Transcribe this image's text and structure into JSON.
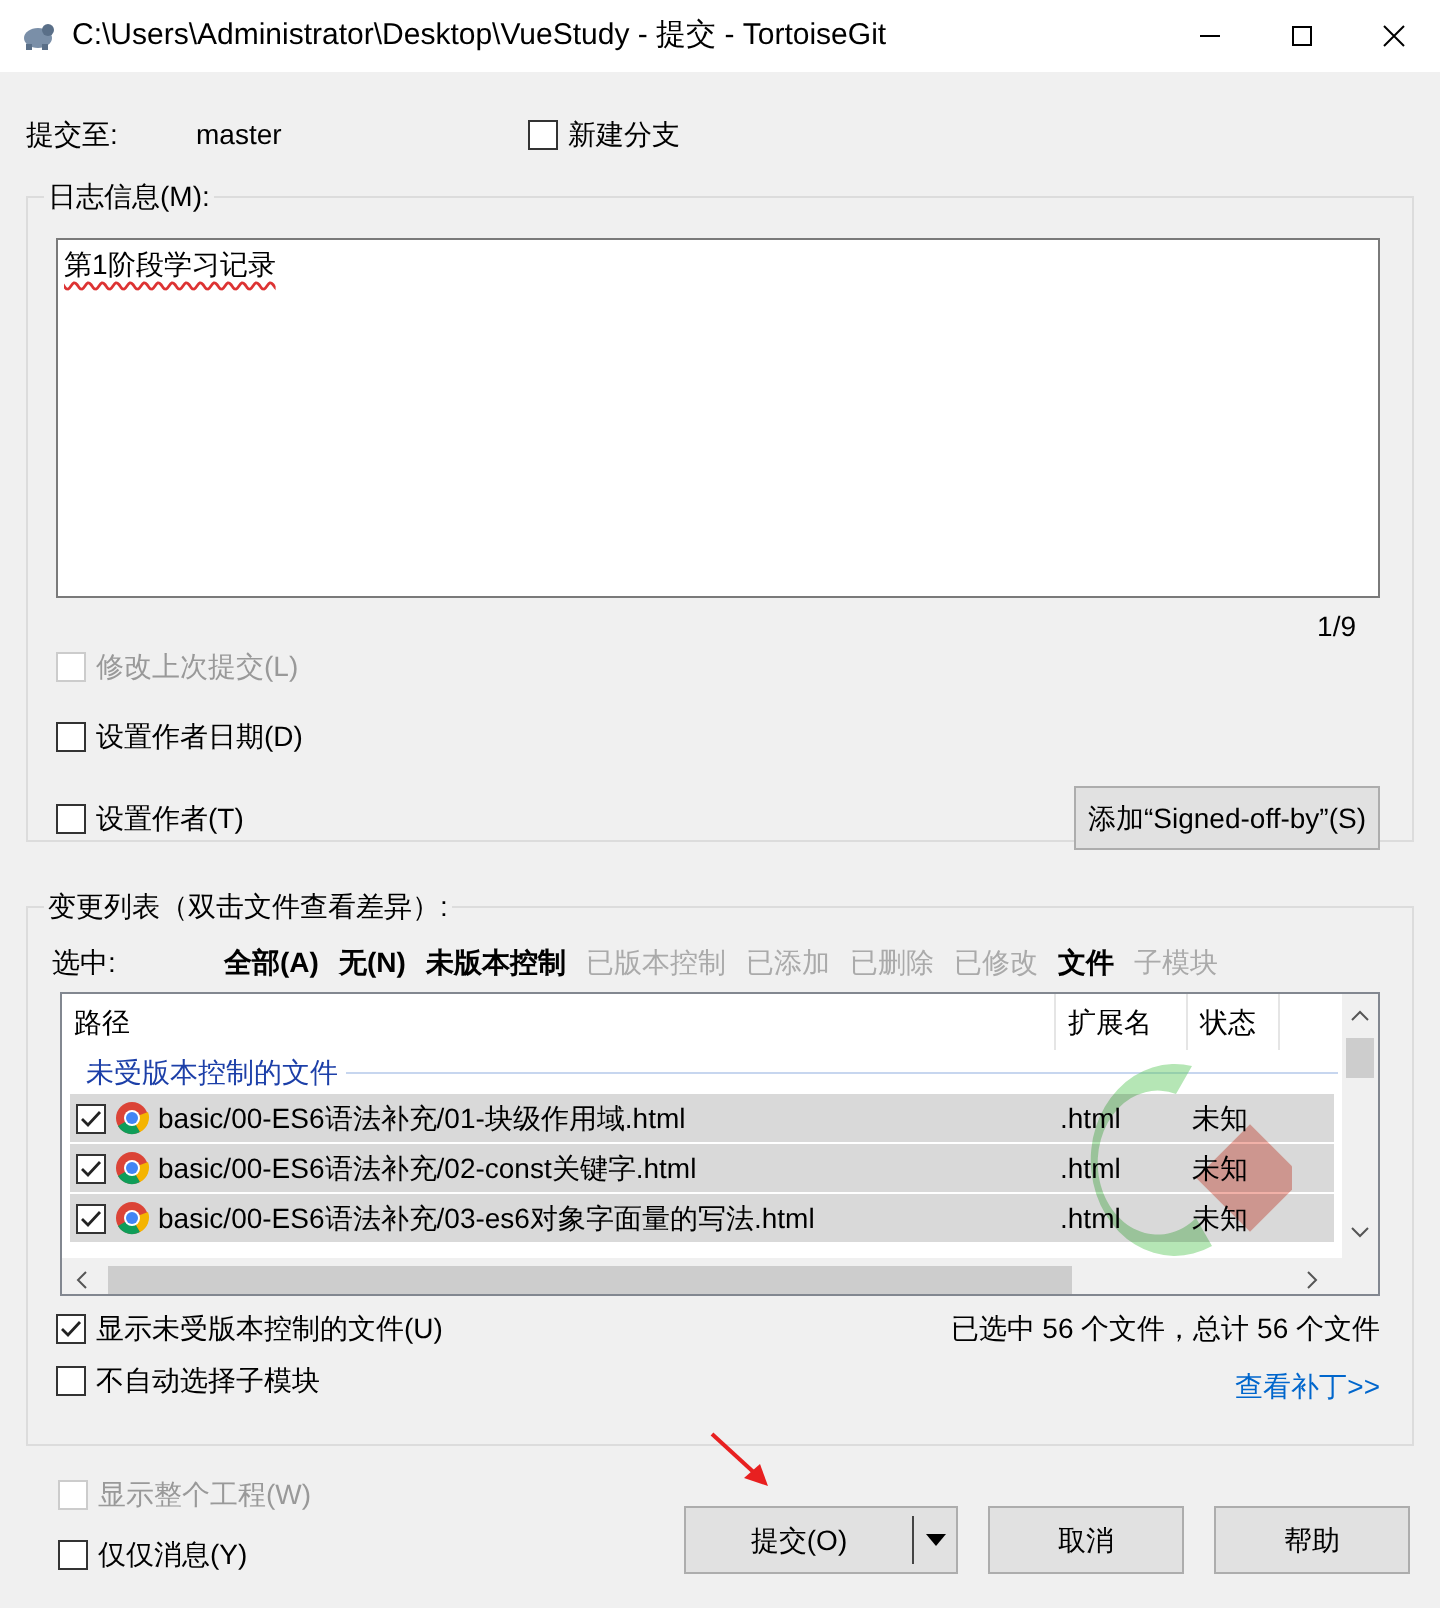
{
  "window": {
    "title": "C:\\Users\\Administrator\\Desktop\\VueStudy - 提交 - TortoiseGit"
  },
  "commit_to": {
    "label": "提交至:",
    "branch": "master"
  },
  "new_branch": {
    "label": "新建分支",
    "checked": false
  },
  "log_message": {
    "legend": "日志信息(M):",
    "value": "第1阶段学习记录",
    "counter": "1/9"
  },
  "options": [
    {
      "label": "修改上次提交(L)",
      "checked": false,
      "disabled": true
    },
    {
      "label": "设置作者日期(D)",
      "checked": false,
      "disabled": false
    },
    {
      "label": "设置作者(T)",
      "checked": false,
      "disabled": false
    }
  ],
  "signoff_button": "添加“Signed-off-by”(S)",
  "changes": {
    "legend": "变更列表（双击文件查看差异）:",
    "select_label": "选中:",
    "filters": [
      {
        "label": "全部(A)",
        "disabled": false
      },
      {
        "label": "无(N)",
        "disabled": false
      },
      {
        "label": "未版本控制",
        "disabled": false
      },
      {
        "label": "已版本控制",
        "disabled": true
      },
      {
        "label": "已添加",
        "disabled": true
      },
      {
        "label": "已删除",
        "disabled": true
      },
      {
        "label": "已修改",
        "disabled": true
      },
      {
        "label": "文件",
        "disabled": false
      },
      {
        "label": "子模块",
        "disabled": true
      }
    ],
    "columns": [
      "路径",
      "扩展名",
      "状态"
    ],
    "group": "未受版本控制的文件",
    "rows": [
      {
        "checked": true,
        "path": "basic/00-ES6语法补充/01-块级作用域.html",
        "ext": ".html",
        "status": "未知"
      },
      {
        "checked": true,
        "path": "basic/00-ES6语法补充/02-const关键字.html",
        "ext": ".html",
        "status": "未知"
      },
      {
        "checked": true,
        "path": "basic/00-ES6语法补充/03-es6对象字面量的写法.html",
        "ext": ".html",
        "status": "未知"
      }
    ],
    "summary": "已选中 56 个文件，总计 56 个文件",
    "options": [
      {
        "label": "显示未受版本控制的文件(U)",
        "checked": true,
        "disabled": false
      },
      {
        "label": "不自动选择子模块",
        "checked": false,
        "disabled": false
      }
    ],
    "patch_link": "查看补丁>>"
  },
  "bottom_options": [
    {
      "label": "显示整个工程(W)",
      "checked": false,
      "disabled": true
    },
    {
      "label": "仅仅消息(Y)",
      "checked": false,
      "disabled": false
    }
  ],
  "buttons": [
    {
      "label": "提交(O)",
      "kind": "split"
    },
    {
      "label": "取消",
      "kind": "plain"
    },
    {
      "label": "帮助",
      "kind": "plain"
    }
  ]
}
